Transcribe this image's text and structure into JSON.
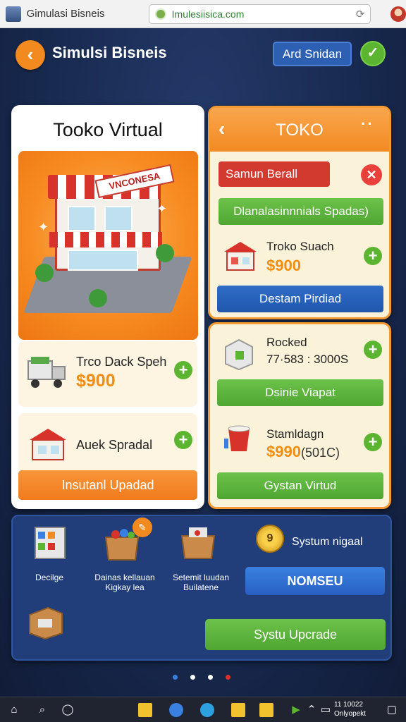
{
  "browser": {
    "tab_title": "Gimulasi Bisneis",
    "url": "Imulesiisica.com"
  },
  "header": {
    "title": "Simulsi Bisneis",
    "action_label": "Ard Snidan"
  },
  "left_panel": {
    "title": "Tooko Virtual",
    "sign_text": "VNCONESA",
    "items": [
      {
        "name": "Trco Dack Speh",
        "price": "$900",
        "icon": "truck-icon"
      },
      {
        "name": "Auek Spradal",
        "icon": "market-stall-icon"
      }
    ],
    "button_label": "Insutanl Upadad"
  },
  "toko_panel": {
    "title": "TOKO",
    "red_button": "Samun Berall",
    "green_button": "Dlanalasinnnials Spadas)",
    "item": {
      "name": "Troko Suach",
      "price": "$900",
      "icon": "store-icon"
    },
    "blue_button": "Destam Pirdiad"
  },
  "rocked_panel": {
    "item1": {
      "name": "Rocked",
      "value": "77·583 : 3000S",
      "icon": "box-icon"
    },
    "green_button1": "Dsinie Viapat",
    "item2": {
      "name": "Stamldagn",
      "price": "$990",
      "price_suffix": "(501C)",
      "icon": "cup-icon"
    },
    "green_button2": "Gystan Virtud"
  },
  "bottom_panel": {
    "tiles": [
      {
        "label": "Decilge",
        "icon": "shelf-icon"
      },
      {
        "label": "Dainas kellauan\nKigkay lea",
        "icon": "toy-box-icon"
      },
      {
        "label": "Setemit luudan\nBuilatene",
        "icon": "crate-icon"
      },
      {
        "label": "",
        "icon": "package-icon"
      }
    ],
    "coin_value": "9",
    "coin_label": "Systum nigaal",
    "nomseu_label": "NOMSEU",
    "upgrade_label": "Systu Upcrade"
  },
  "taskbar": {
    "time": "11 10022",
    "date": "Onlyopekt"
  },
  "colors": {
    "accent_orange": "#f28a1f",
    "green": "#5cb531",
    "blue": "#2d5fb3",
    "red": "#d23a2f",
    "navy": "#1b2b52"
  }
}
